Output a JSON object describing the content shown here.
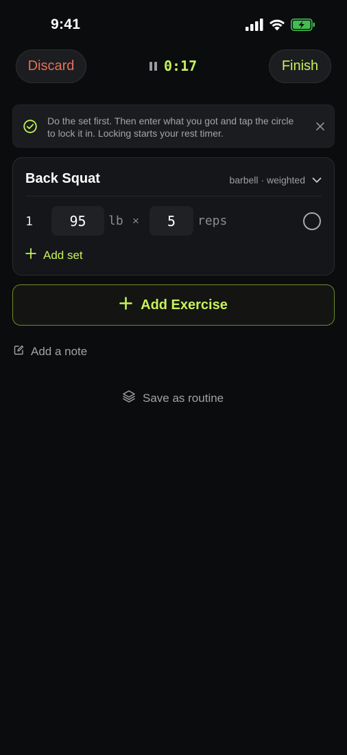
{
  "status_bar": {
    "time": "9:41",
    "icons": [
      "cellular-signal-icon",
      "wifi-icon",
      "battery-charging-icon"
    ]
  },
  "header": {
    "discard_label": "Discard",
    "timer": "0:17",
    "finish_label": "Finish"
  },
  "tip": {
    "text": "Do the set first. Then enter what you got and tap the circle to lock it in. Locking starts your rest timer."
  },
  "exercise": {
    "name": "Back Squat",
    "tags": "barbell · weighted",
    "sets": [
      {
        "number": "1",
        "weight": "95",
        "weight_unit": "lb",
        "times": "×",
        "reps": "5",
        "reps_unit": "reps",
        "locked": false
      }
    ],
    "add_set_label": "Add set"
  },
  "actions": {
    "add_exercise_label": "Add Exercise",
    "add_note_label": "Add a note",
    "save_routine_label": "Save as routine"
  },
  "colors": {
    "background": "#0b0c0e",
    "accent": "#c6f25a",
    "discard": "#e8705a",
    "muted_text": "#a0a2a7"
  }
}
